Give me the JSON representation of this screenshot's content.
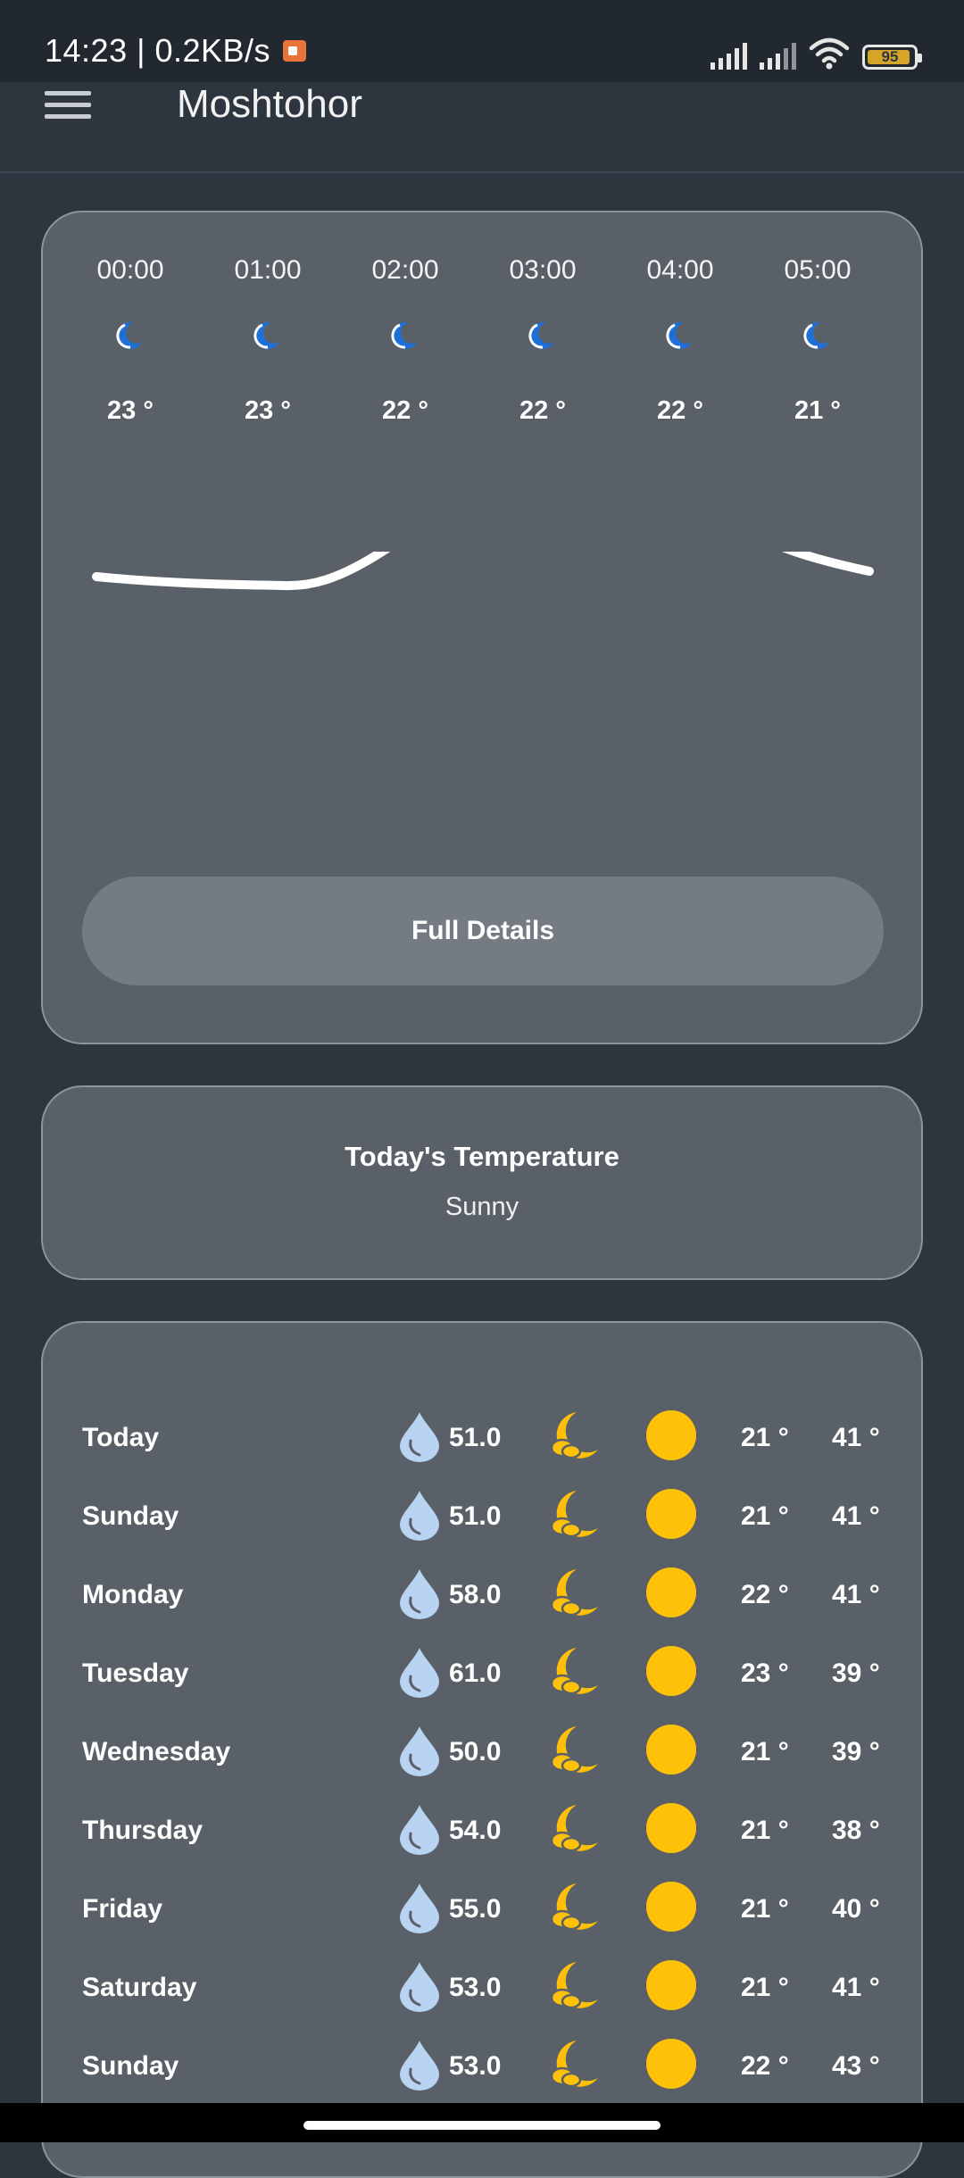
{
  "status_bar": {
    "time_speed": "14:23 | 0.2KB/s",
    "battery": "95"
  },
  "app_bar": {
    "title": "Moshtohor"
  },
  "hourly": [
    {
      "time": "00:00",
      "temp": "23 °",
      "icon": "moon-icon"
    },
    {
      "time": "01:00",
      "temp": "23 °",
      "icon": "moon-icon"
    },
    {
      "time": "02:00",
      "temp": "22 °",
      "icon": "moon-icon"
    },
    {
      "time": "03:00",
      "temp": "22 °",
      "icon": "moon-icon"
    },
    {
      "time": "04:00",
      "temp": "22 °",
      "icon": "moon-icon"
    },
    {
      "time": "05:00",
      "temp": "21 °",
      "icon": "moon-icon"
    }
  ],
  "full_details_label": "Full Details",
  "today": {
    "title": "Today's Temperature",
    "condition": "Sunny"
  },
  "daily": [
    {
      "day": "Today",
      "humidity": "51.0",
      "min": "21 °",
      "max": "41 °"
    },
    {
      "day": "Sunday",
      "humidity": "51.0",
      "min": "21 °",
      "max": "41 °"
    },
    {
      "day": "Monday",
      "humidity": "58.0",
      "min": "22 °",
      "max": "41 °"
    },
    {
      "day": "Tuesday",
      "humidity": "61.0",
      "min": "23 °",
      "max": "39 °"
    },
    {
      "day": "Wednesday",
      "humidity": "50.0",
      "min": "21 °",
      "max": "39 °"
    },
    {
      "day": "Thursday",
      "humidity": "54.0",
      "min": "21 °",
      "max": "38 °"
    },
    {
      "day": "Friday",
      "humidity": "55.0",
      "min": "21 °",
      "max": "40 °"
    },
    {
      "day": "Saturday",
      "humidity": "53.0",
      "min": "21 °",
      "max": "41 °"
    },
    {
      "day": "Sunday",
      "humidity": "53.0",
      "min": "22 °",
      "max": "43 °"
    }
  ],
  "colors": {
    "background": "#2d353e",
    "card": "#5a6068",
    "accent_sun": "#ffc107",
    "drop": "#b9d3f2",
    "moon_hourly": "#1e6fd9"
  }
}
